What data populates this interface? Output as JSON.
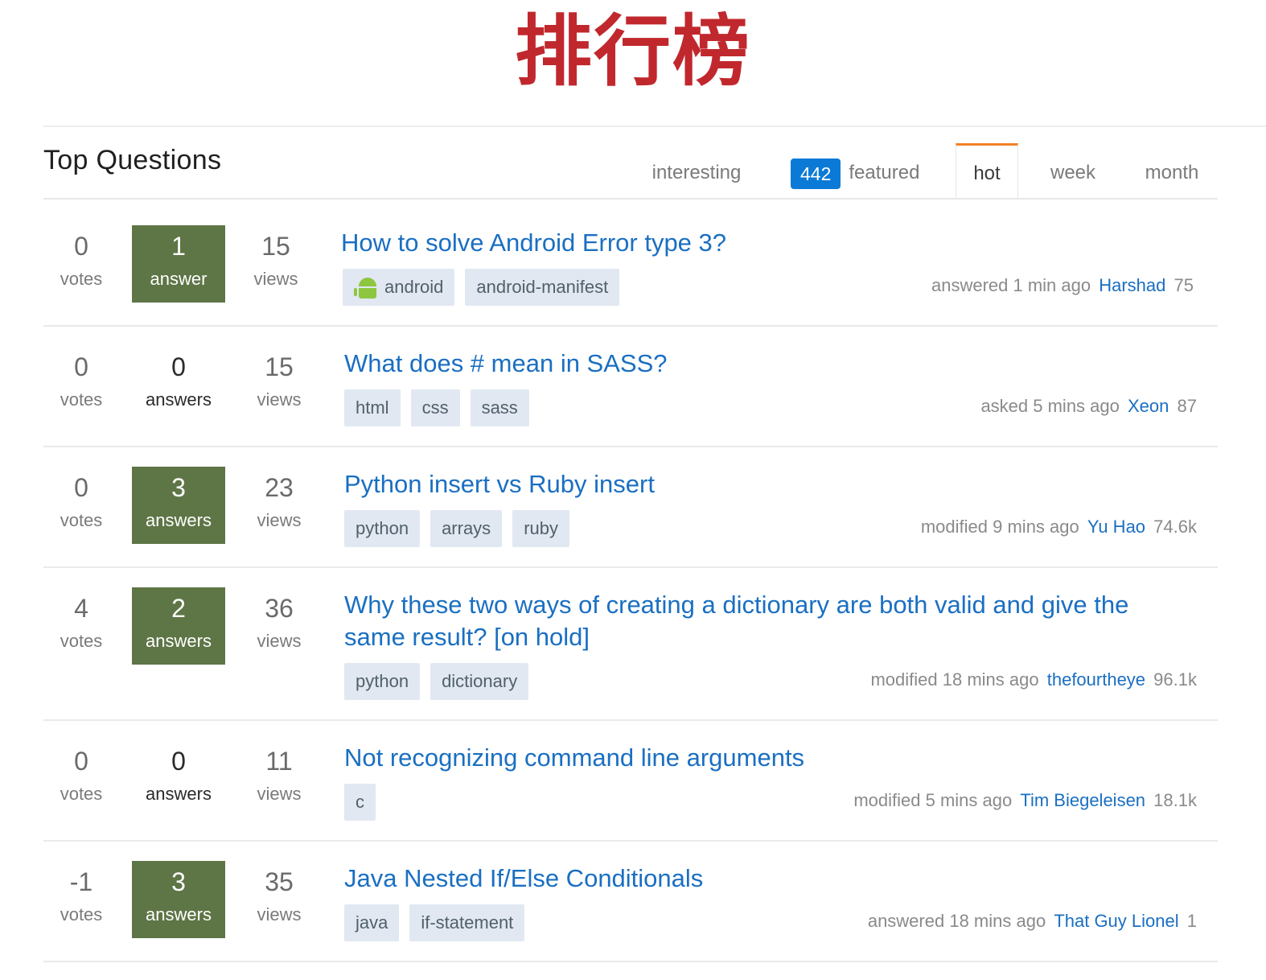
{
  "banner": "排行榜",
  "header": {
    "title": "Top Questions",
    "tabs": {
      "interesting": "interesting",
      "featured_count": "442",
      "featured": "featured",
      "hot": "hot",
      "week": "week",
      "month": "month"
    }
  },
  "questions": [
    {
      "votes": "0",
      "votes_label": "votes",
      "answers": "1",
      "answers_label": "answer",
      "views": "15",
      "views_label": "views",
      "title": "How to solve Android Error type 3?",
      "tags": [
        "android",
        "android-manifest"
      ],
      "activity": "answered 1 min ago",
      "user": "Harshad",
      "rep": "75"
    },
    {
      "votes": "0",
      "votes_label": "votes",
      "answers": "0",
      "answers_label": "answers",
      "views": "15",
      "views_label": "views",
      "title": "What does # mean in SASS?",
      "tags": [
        "html",
        "css",
        "sass"
      ],
      "activity": "asked 5 mins ago",
      "user": "Xeon",
      "rep": "87"
    },
    {
      "votes": "0",
      "votes_label": "votes",
      "answers": "3",
      "answers_label": "answers",
      "views": "23",
      "views_label": "views",
      "title": "Python insert vs Ruby insert",
      "tags": [
        "python",
        "arrays",
        "ruby"
      ],
      "activity": "modified 9 mins ago",
      "user": "Yu Hao",
      "rep": "74.6k"
    },
    {
      "votes": "4",
      "votes_label": "votes",
      "answers": "2",
      "answers_label": "answers",
      "views": "36",
      "views_label": "views",
      "title": "Why these two ways of creating a dictionary are both valid and give the same result? [on hold]",
      "tags": [
        "python",
        "dictionary"
      ],
      "activity": "modified 18 mins ago",
      "user": "thefourtheye",
      "rep": "96.1k"
    },
    {
      "votes": "0",
      "votes_label": "votes",
      "answers": "0",
      "answers_label": "answers",
      "views": "11",
      "views_label": "views",
      "title": "Not recognizing command line arguments",
      "tags": [
        "c"
      ],
      "activity": "modified 5 mins ago",
      "user": "Tim Biegeleisen",
      "rep": "18.1k"
    },
    {
      "votes": "-1",
      "votes_label": "votes",
      "answers": "3",
      "answers_label": "answers",
      "views": "35",
      "views_label": "views",
      "title": "Java Nested If/Else Conditionals",
      "tags": [
        "java",
        "if-statement"
      ],
      "activity": "answered 18 mins ago",
      "user": "That Guy Lionel",
      "rep": "1"
    }
  ],
  "colors": {
    "banner": "#c0282d",
    "link": "#1a6fc2",
    "answered_box": "#5e7546",
    "tag_bg": "#e1e8f1",
    "featured_badge": "#0a7ad6",
    "active_tab_accent": "#f48024"
  },
  "icons": {
    "android_tag": "android-robot-icon"
  }
}
